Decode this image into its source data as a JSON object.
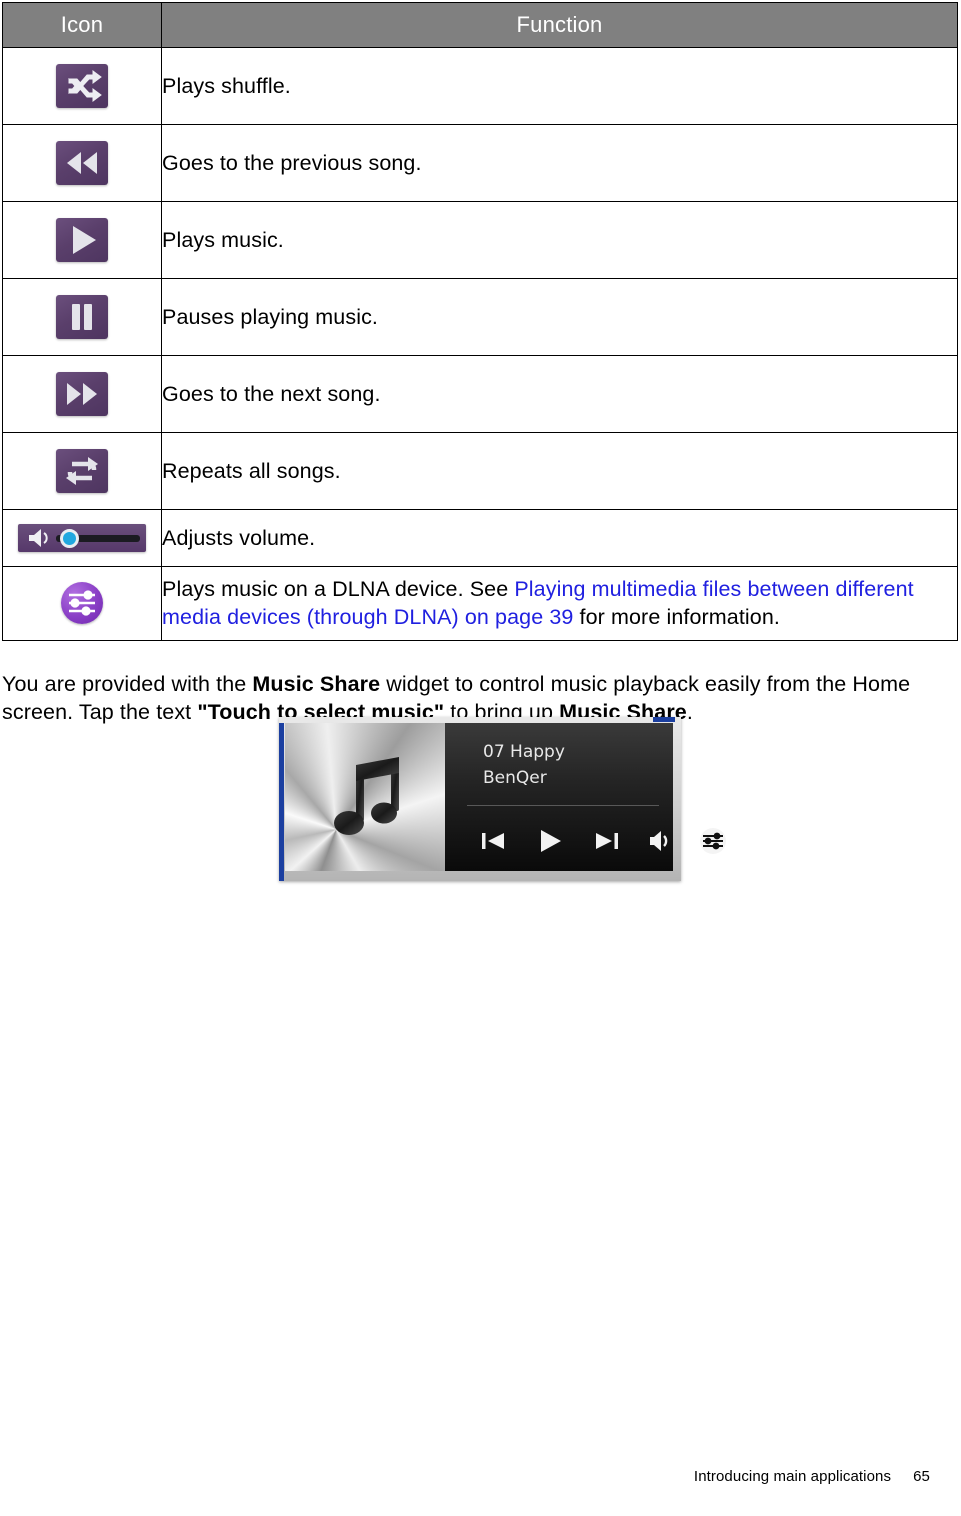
{
  "table": {
    "headers": {
      "icon": "Icon",
      "function": "Function"
    },
    "rows": [
      {
        "icon_name": "shuffle-icon",
        "text": "Plays shuffle."
      },
      {
        "icon_name": "previous-icon",
        "text": "Goes to the previous song."
      },
      {
        "icon_name": "play-icon",
        "text": "Plays music."
      },
      {
        "icon_name": "pause-icon",
        "text": "Pauses playing music."
      },
      {
        "icon_name": "next-icon",
        "text": "Goes to the next song."
      },
      {
        "icon_name": "repeat-icon",
        "text": "Repeats all songs."
      },
      {
        "icon_name": "volume-slider-icon",
        "text": "Adjusts volume."
      }
    ],
    "dlna_row": {
      "icon_name": "dlna-icon",
      "text_before": "Plays music on a DLNA device. See ",
      "link_text": "Playing multimedia files between different media devices (through DLNA) on page 39",
      "text_after": " for more information."
    }
  },
  "paragraph": {
    "seg1": "You are provided with the ",
    "bold1": "Music Share",
    "seg2": " widget to control music playback easily from the Home screen. Tap the text ",
    "bold2": "\"Touch to select music\"",
    "seg3": " to bring up ",
    "bold3": "Music Share",
    "seg4": "."
  },
  "widget": {
    "track_title": "07 Happy",
    "artist": "BenQer",
    "controls": [
      {
        "name": "widget-previous-button",
        "label": "previous"
      },
      {
        "name": "widget-play-button",
        "label": "play"
      },
      {
        "name": "widget-next-button",
        "label": "next"
      },
      {
        "name": "widget-volume-button",
        "label": "volume"
      },
      {
        "name": "widget-dlna-button",
        "label": "dlna"
      }
    ]
  },
  "footer": {
    "section": "Introducing main applications",
    "page": "65"
  },
  "colors": {
    "header_gray": "#808080",
    "icon_purple": "#5a3f6b",
    "link_blue": "#2020e0",
    "knob_blue": "#21a8e0",
    "dlna_purple": "#8a3fc6"
  }
}
